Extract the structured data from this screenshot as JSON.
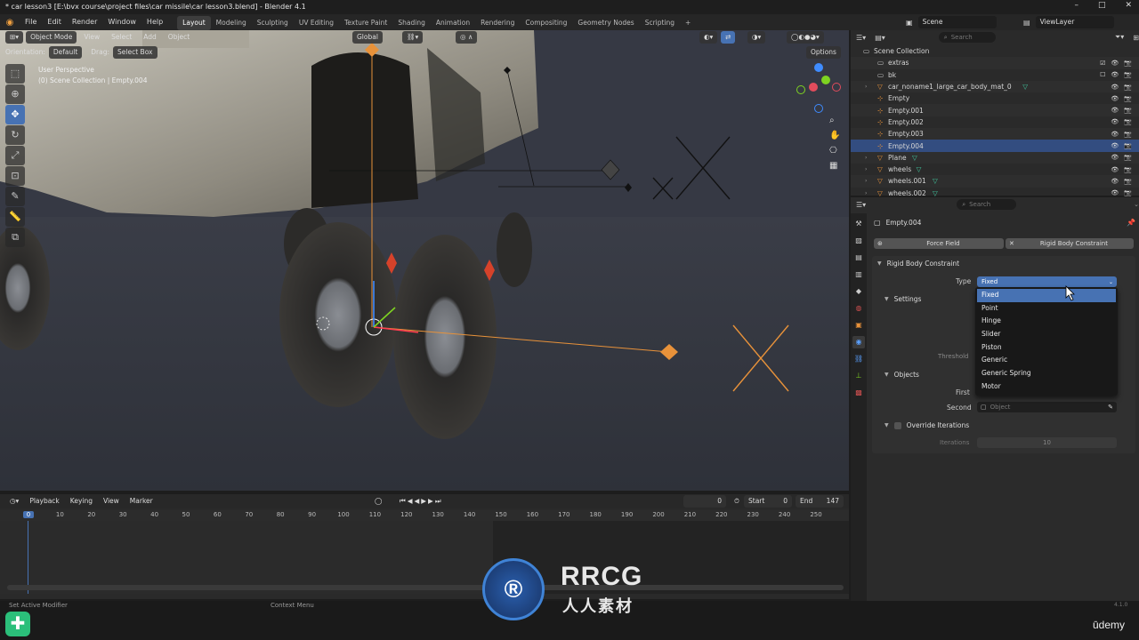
{
  "window": {
    "title": "* car lesson3 [E:\\bvx course\\project files\\car missile\\car lesson3.blend] - Blender 4.1",
    "controls": [
      "–",
      "□",
      "✕"
    ]
  },
  "menubar": {
    "menus": [
      "File",
      "Edit",
      "Render",
      "Window",
      "Help"
    ],
    "workspaces": [
      "Layout",
      "Modeling",
      "Sculpting",
      "UV Editing",
      "Texture Paint",
      "Shading",
      "Animation",
      "Rendering",
      "Compositing",
      "Geometry Nodes",
      "Scripting"
    ],
    "active_workspace": "Layout",
    "add_workspace": "+",
    "scene_label": "Scene",
    "view_layer_label": "ViewLayer"
  },
  "viewport_header": {
    "mode": "Object Mode",
    "menus": [
      "View",
      "Select",
      "Add",
      "Object"
    ],
    "transform_orientation": "Global",
    "options_label": "Options",
    "orientation_label": "Orientation:",
    "orientation_value": "Default",
    "drag_label": "Drag:",
    "drag_value": "Select Box"
  },
  "viewport": {
    "perspective_text": "User Perspective",
    "collection_text": "(0) Scene Collection | Empty.004",
    "bg_color": "#363944"
  },
  "tools": [
    "select-box",
    "cursor",
    "move",
    "rotate",
    "scale",
    "transform",
    "annotate",
    "measure",
    "add-cube"
  ],
  "timeline": {
    "menus": [
      "Playback",
      "Keying",
      "View",
      "Marker"
    ],
    "current_frame": "0",
    "start_label": "Start",
    "start_value": "0",
    "end_label": "End",
    "end_value": "147",
    "ruler_ticks": [
      "0",
      "10",
      "20",
      "30",
      "40",
      "50",
      "60",
      "70",
      "80",
      "90",
      "100",
      "110",
      "120",
      "130",
      "140",
      "150",
      "160",
      "170",
      "180",
      "190",
      "200",
      "210",
      "220",
      "230",
      "240",
      "250"
    ]
  },
  "statusbar": {
    "left_text": "Set Active Modifier",
    "mid_text": "Context Menu",
    "version": "4.1.0"
  },
  "outliner": {
    "search_placeholder": "Search",
    "items": [
      {
        "label": "Scene Collection",
        "type": "scene-collection"
      },
      {
        "label": "extras",
        "type": "collection"
      },
      {
        "label": "bk",
        "type": "collection"
      },
      {
        "label": "car_noname1_large_car_body_mat_0",
        "type": "mesh"
      },
      {
        "label": "Empty",
        "type": "empty"
      },
      {
        "label": "Empty.001",
        "type": "empty"
      },
      {
        "label": "Empty.002",
        "type": "empty"
      },
      {
        "label": "Empty.003",
        "type": "empty"
      },
      {
        "label": "Empty.004",
        "type": "empty"
      },
      {
        "label": "Plane",
        "type": "mesh"
      },
      {
        "label": "wheels",
        "type": "mesh"
      },
      {
        "label": "wheels.001",
        "type": "mesh"
      },
      {
        "label": "wheels.002",
        "type": "mesh"
      }
    ],
    "selected_index": 8
  },
  "properties": {
    "search_placeholder": "Search",
    "object_name": "Empty.004",
    "force_field_button": "Force Field",
    "rigid_body_constraint_button": "Rigid Body Constraint",
    "panel_title": "Rigid Body Constraint",
    "type_label": "Type",
    "type_value": "Fixed",
    "settings_label": "Settings",
    "threshold_label": "Threshold",
    "objects_label": "Objects",
    "first_label": "First",
    "second_label": "Second",
    "second_placeholder": "Object",
    "override_iterations_label": "Override Iterations",
    "iterations_label": "Iterations",
    "iterations_value": "10",
    "type_options": [
      "Fixed",
      "Point",
      "Hinge",
      "Slider",
      "Piston",
      "Generic",
      "Generic Spring",
      "Motor"
    ],
    "selected_option_index": 0
  },
  "watermark": {
    "brand": "RRCG",
    "subtitle": "人人素材",
    "udemy": "ūdemy"
  },
  "colors": {
    "accent": "#4772b3",
    "selection_row": "#334d80",
    "empty_orange": "#e8923a"
  }
}
